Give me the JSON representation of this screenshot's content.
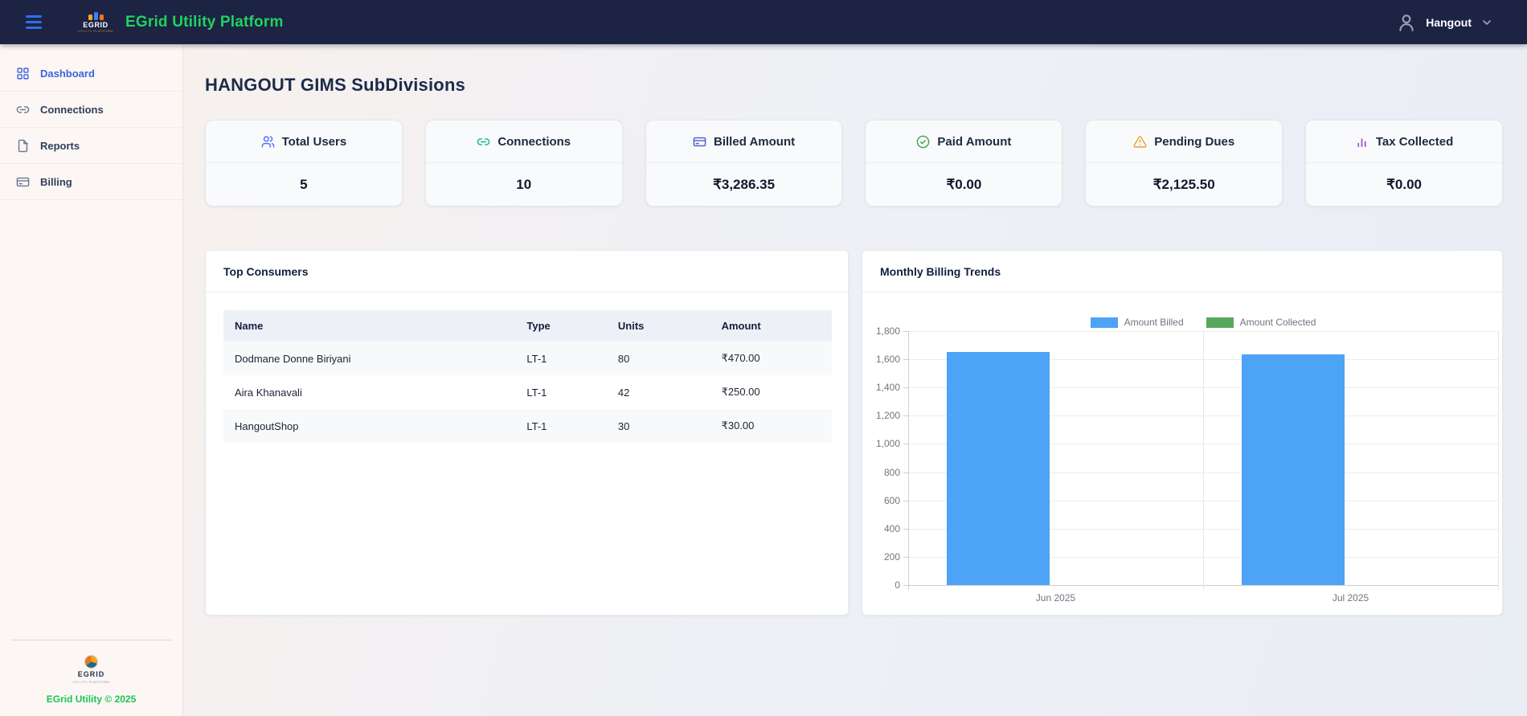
{
  "navbar": {
    "title": "EGrid Utility Platform",
    "logo_text": "EGRID",
    "logo_subtext": "UTILITY PLATFORM",
    "user_name": "Hangout"
  },
  "colors": {
    "brand_green": "#1fd35f",
    "navbar_bg": "#1d2343",
    "active_blue": "#3d63dd"
  },
  "sidebar": {
    "items": [
      {
        "label": "Dashboard",
        "icon": "grid",
        "active": true
      },
      {
        "label": "Connections",
        "icon": "link",
        "active": false
      },
      {
        "label": "Reports",
        "icon": "file",
        "active": false
      },
      {
        "label": "Billing",
        "icon": "card",
        "active": false
      }
    ],
    "footer": {
      "logo_text": "EGRID",
      "logo_subtext": "UTILITY PLATFORM",
      "copyright": "EGrid Utility © 2025"
    }
  },
  "main": {
    "page_title": "HANGOUT GIMS SubDivisions",
    "stats": [
      {
        "label": "Total Users",
        "value": "5",
        "icon": "users",
        "color": "#4f6ef7"
      },
      {
        "label": "Connections",
        "value": "10",
        "icon": "link",
        "color": "#10b981"
      },
      {
        "label": "Billed Amount",
        "value": "₹3,286.35",
        "icon": "card",
        "color": "#4a5cd0"
      },
      {
        "label": "Paid Amount",
        "value": "₹0.00",
        "icon": "check",
        "color": "#43a047"
      },
      {
        "label": "Pending Dues",
        "value": "₹2,125.50",
        "icon": "warning",
        "color": "#f0a020"
      },
      {
        "label": "Tax Collected",
        "value": "₹0.00",
        "icon": "bar-chart",
        "color": "#a34fc2"
      }
    ],
    "top_consumers": {
      "title": "Top Consumers",
      "columns": [
        "Name",
        "Type",
        "Units",
        "Amount"
      ],
      "rows": [
        [
          "Dodmane Donne Biriyani",
          "LT-1",
          "80",
          "₹470.00"
        ],
        [
          "Aira Khanavali",
          "LT-1",
          "42",
          "₹250.00"
        ],
        [
          "HangoutShop",
          "LT-1",
          "30",
          "₹30.00"
        ]
      ]
    },
    "billing_trends": {
      "title": "Monthly Billing Trends"
    }
  },
  "chart_data": {
    "type": "bar",
    "title": "Monthly Billing Trends",
    "categories": [
      "Jun 2025",
      "Jul 2025"
    ],
    "series": [
      {
        "name": "Amount Billed",
        "color": "#4da3f5",
        "values": [
          1650,
          1636
        ]
      },
      {
        "name": "Amount Collected",
        "color": "#57a85c",
        "values": [
          0,
          0
        ]
      }
    ],
    "ylim": [
      0,
      1800
    ],
    "ytick_step": 200,
    "grid": true,
    "legend_position": "top"
  }
}
